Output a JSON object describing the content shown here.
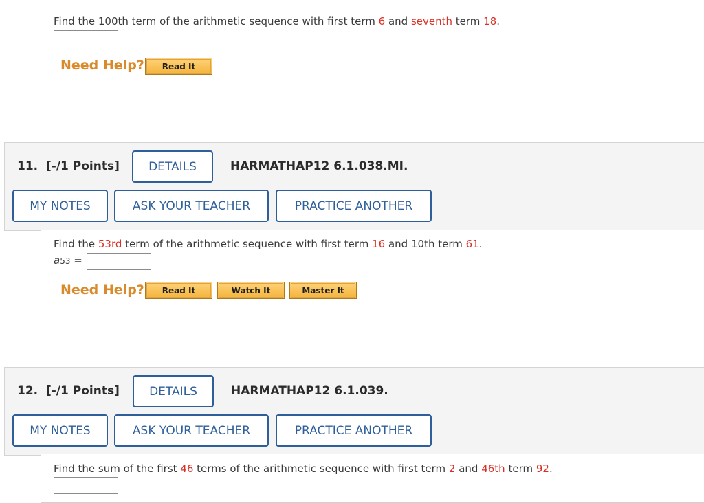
{
  "q10": {
    "text": [
      "Find the 100th term of the arithmetic sequence with first term ",
      "6",
      " and ",
      "seventh",
      " term ",
      "18",
      "."
    ],
    "need_help": "Need Help?",
    "read_it": "Read It"
  },
  "q11": {
    "number": "11.",
    "points": "[-/1 Points]",
    "details": "DETAILS",
    "code": "HARMATHAP12 6.1.038.MI.",
    "my_notes": "MY NOTES",
    "ask_teacher": "ASK YOUR TEACHER",
    "practice": "PRACTICE ANOTHER",
    "text": [
      "Find the ",
      "53rd",
      " term of the arithmetic sequence with first term ",
      "16",
      " and 10th term ",
      "61",
      "."
    ],
    "answer_label_var": "a",
    "answer_label_sub": "53",
    "answer_label_eq": "=",
    "need_help": "Need Help?",
    "read_it": "Read It",
    "watch_it": "Watch It",
    "master_it": "Master It"
  },
  "q12": {
    "number": "12.",
    "points": "[-/1 Points]",
    "details": "DETAILS",
    "code": "HARMATHAP12 6.1.039.",
    "my_notes": "MY NOTES",
    "ask_teacher": "ASK YOUR TEACHER",
    "practice": "PRACTICE ANOTHER",
    "text": [
      "Find the sum of the first ",
      "46",
      " terms of the arithmetic sequence with first term ",
      "2",
      " and ",
      "46th",
      " term ",
      "92",
      "."
    ]
  }
}
